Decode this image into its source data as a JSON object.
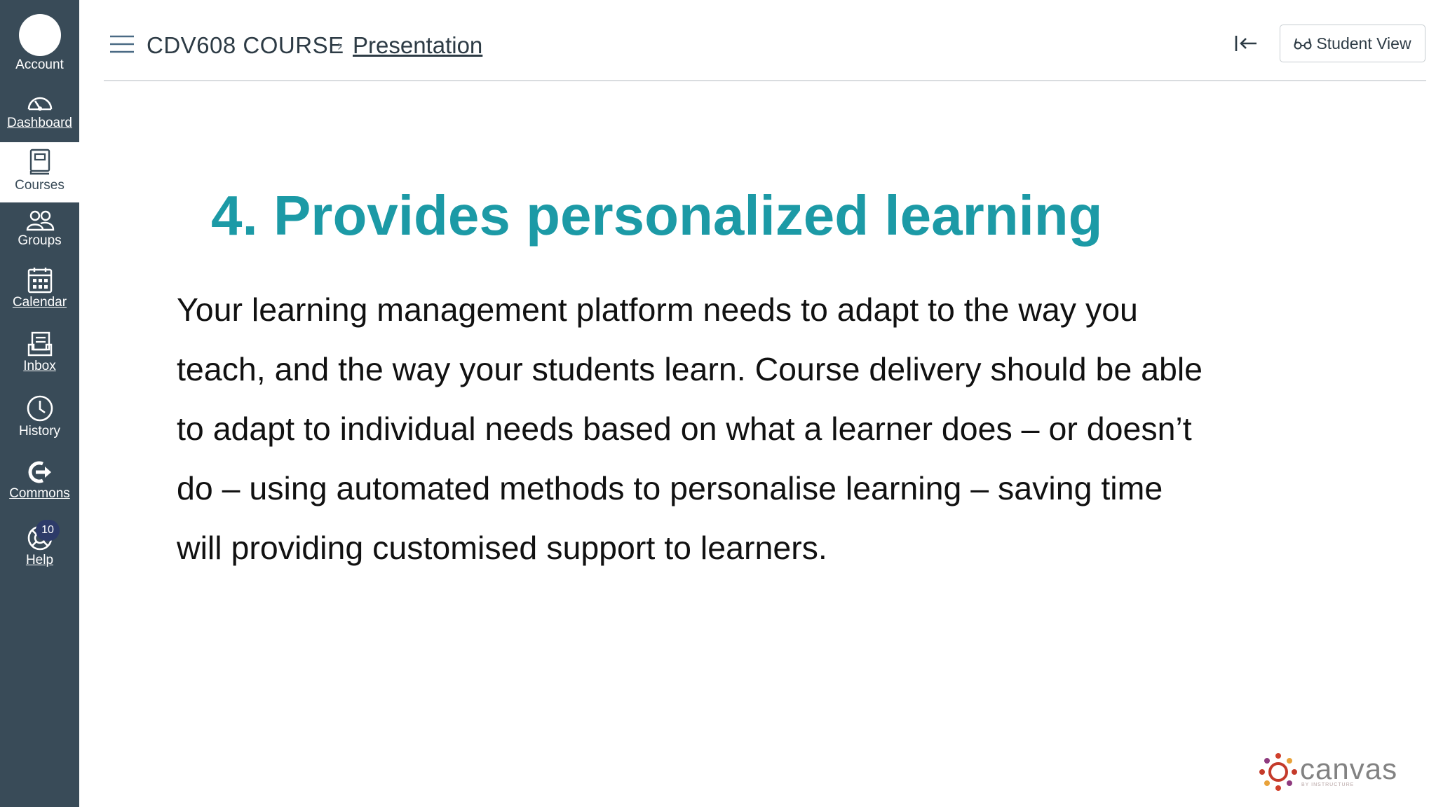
{
  "nav": {
    "account": "Account",
    "dashboard": "Dashboard",
    "courses": "Courses",
    "groups": "Groups",
    "calendar": "Calendar",
    "inbox": "Inbox",
    "history": "History",
    "commons": "Commons",
    "help": "Help",
    "help_badge": "10"
  },
  "header": {
    "course_name": "CDV608 COURSE",
    "separator": "›",
    "page_name": "Presentation",
    "student_view": "Student View"
  },
  "slide": {
    "title": "4. Provides personalized learning",
    "lines": [
      "Your learning management platform needs to adapt to the way you",
      "teach, and the way your students learn. Course delivery should be able",
      "to adapt to individual needs based on what a learner does – or doesn’t",
      "do – using automated methods to personalise learning – saving time",
      "will providing customised support to learners."
    ]
  },
  "logo": {
    "word": "canvas",
    "sub": "BY INSTRUCTURE"
  },
  "colors": {
    "nav_bg": "#394b58",
    "title": "#1c9aa6",
    "badge": "#2d3b69"
  }
}
